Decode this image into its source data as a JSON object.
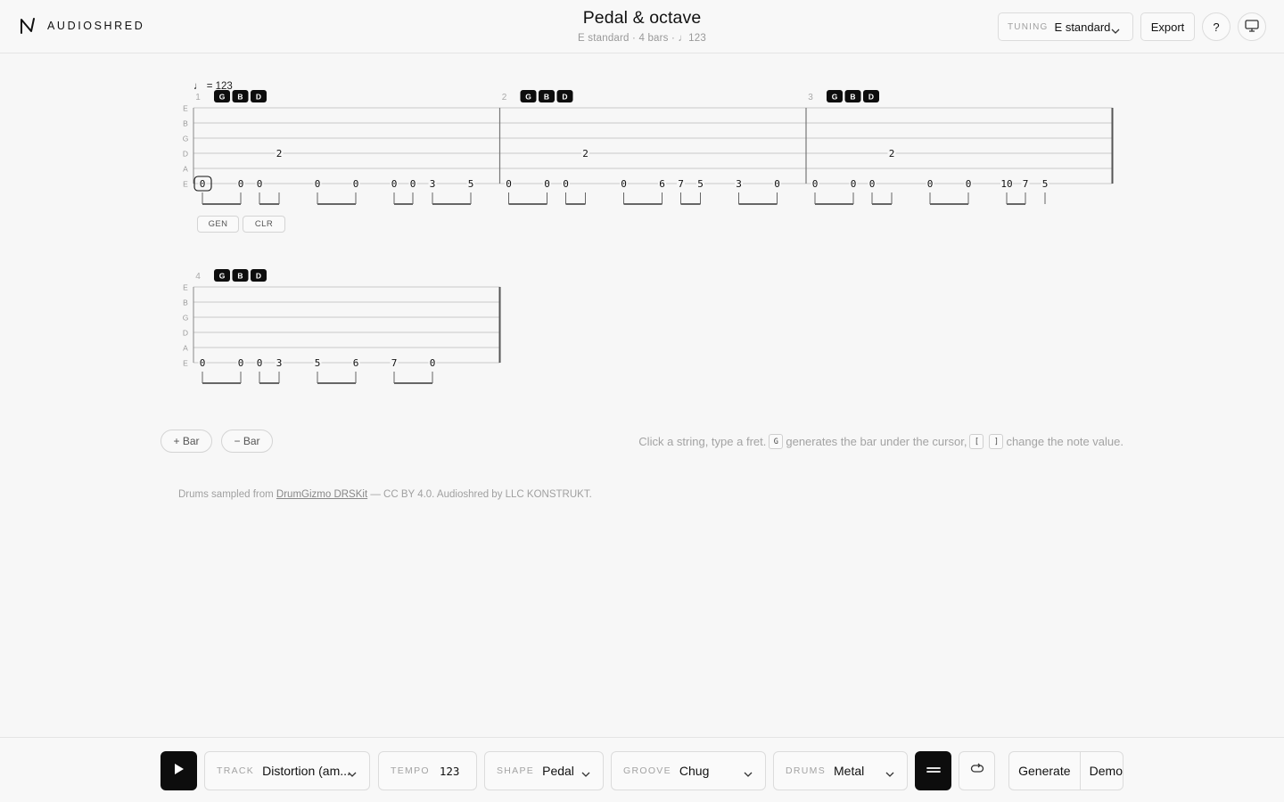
{
  "app": {
    "brand": "AUDIOSHRED"
  },
  "document": {
    "title": "Pedal & octave",
    "meta": "E standard · 4 bars · ♩123"
  },
  "header": {
    "tuning_label": "TUNING",
    "tuning_value": "E standard",
    "export_label": "Export",
    "help_label": "?"
  },
  "tab": {
    "tempo_marking": "♩ = 123",
    "string_names": [
      "E",
      "B",
      "G",
      "D",
      "A",
      "E"
    ],
    "chord_badges": [
      "G",
      "B",
      "D"
    ],
    "bars": [
      {
        "number": "1",
        "notes": [
          {
            "string": 6,
            "fret": "0",
            "selected": true
          },
          {
            "string": 6,
            "fret": "0"
          },
          {
            "string": 6,
            "fret": "0"
          },
          {
            "string": 4,
            "fret": "2"
          },
          {
            "string": 6,
            "fret": "0"
          },
          {
            "string": 6,
            "fret": "0"
          },
          {
            "string": 6,
            "fret": "0"
          },
          {
            "string": 6,
            "fret": "0"
          },
          {
            "string": 6,
            "fret": "3"
          },
          {
            "string": 6,
            "fret": "5"
          }
        ]
      },
      {
        "number": "2",
        "notes": [
          {
            "string": 6,
            "fret": "0"
          },
          {
            "string": 6,
            "fret": "0"
          },
          {
            "string": 6,
            "fret": "0"
          },
          {
            "string": 4,
            "fret": "2"
          },
          {
            "string": 6,
            "fret": "0"
          },
          {
            "string": 6,
            "fret": "6"
          },
          {
            "string": 6,
            "fret": "7"
          },
          {
            "string": 6,
            "fret": "5"
          },
          {
            "string": 6,
            "fret": "3"
          },
          {
            "string": 6,
            "fret": "0"
          }
        ]
      },
      {
        "number": "3",
        "notes": [
          {
            "string": 6,
            "fret": "0"
          },
          {
            "string": 6,
            "fret": "0"
          },
          {
            "string": 6,
            "fret": "0"
          },
          {
            "string": 4,
            "fret": "2"
          },
          {
            "string": 6,
            "fret": "0"
          },
          {
            "string": 6,
            "fret": "0"
          },
          {
            "string": 6,
            "fret": "10"
          },
          {
            "string": 6,
            "fret": "7"
          },
          {
            "string": 6,
            "fret": "5"
          }
        ]
      },
      {
        "number": "4",
        "notes": [
          {
            "string": 6,
            "fret": "0"
          },
          {
            "string": 6,
            "fret": "0"
          },
          {
            "string": 6,
            "fret": "0"
          },
          {
            "string": 6,
            "fret": "3"
          },
          {
            "string": 6,
            "fret": "5"
          },
          {
            "string": 6,
            "fret": "6"
          },
          {
            "string": 6,
            "fret": "7"
          },
          {
            "string": 6,
            "fret": "0"
          }
        ]
      }
    ],
    "bar_tools": {
      "gen_label": "GEN",
      "clr_label": "CLR"
    }
  },
  "editor": {
    "add_bar_label": "+ Bar",
    "remove_bar_label": "− Bar",
    "hint": {
      "part1": "Click a string, type a fret.",
      "key_generate": "G",
      "part2": "generates the bar under the cursor,",
      "key_prev": "[",
      "key_next": "]",
      "part3": "change the note value."
    },
    "credits": {
      "prefix": "Drums sampled from",
      "link": "DrumGizmo DRSKit",
      "suffix": "— CC BY 4.0. Audioshred by LLC KONSTRUKT."
    }
  },
  "transport": {
    "track_label": "TRACK",
    "track_value": "Distortion (am...",
    "tempo_label": "TEMPO",
    "tempo_value": "123",
    "shape_label": "SHAPE",
    "shape_value": "Pedal",
    "groove_label": "GROOVE",
    "groove_value": "Chug",
    "drums_label": "DRUMS",
    "drums_value": "Metal",
    "generate_label": "Generate",
    "demo_label": "Demo"
  },
  "colors": {
    "accent": "#0d0d0d",
    "background": "#f7f7f7",
    "staff_line": "#c8c8c8",
    "muted_text": "#a0a0a0"
  }
}
